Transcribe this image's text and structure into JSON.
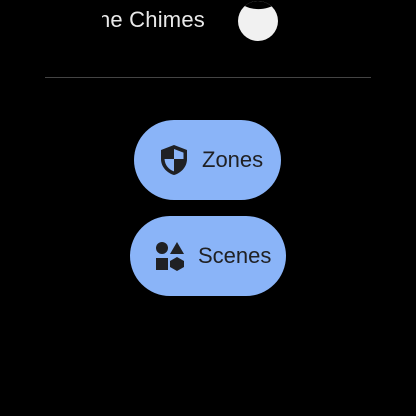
{
  "chime": {
    "label": "ne Chimes",
    "toggle_state": "on"
  },
  "menu": {
    "items": [
      {
        "label": "Zones",
        "icon": "shield-icon"
      },
      {
        "label": "Scenes",
        "icon": "shapes-icon"
      }
    ]
  },
  "colors": {
    "background": "#000000",
    "pill": "#8ab4f8",
    "pill_text": "#202124",
    "divider": "#444444"
  }
}
